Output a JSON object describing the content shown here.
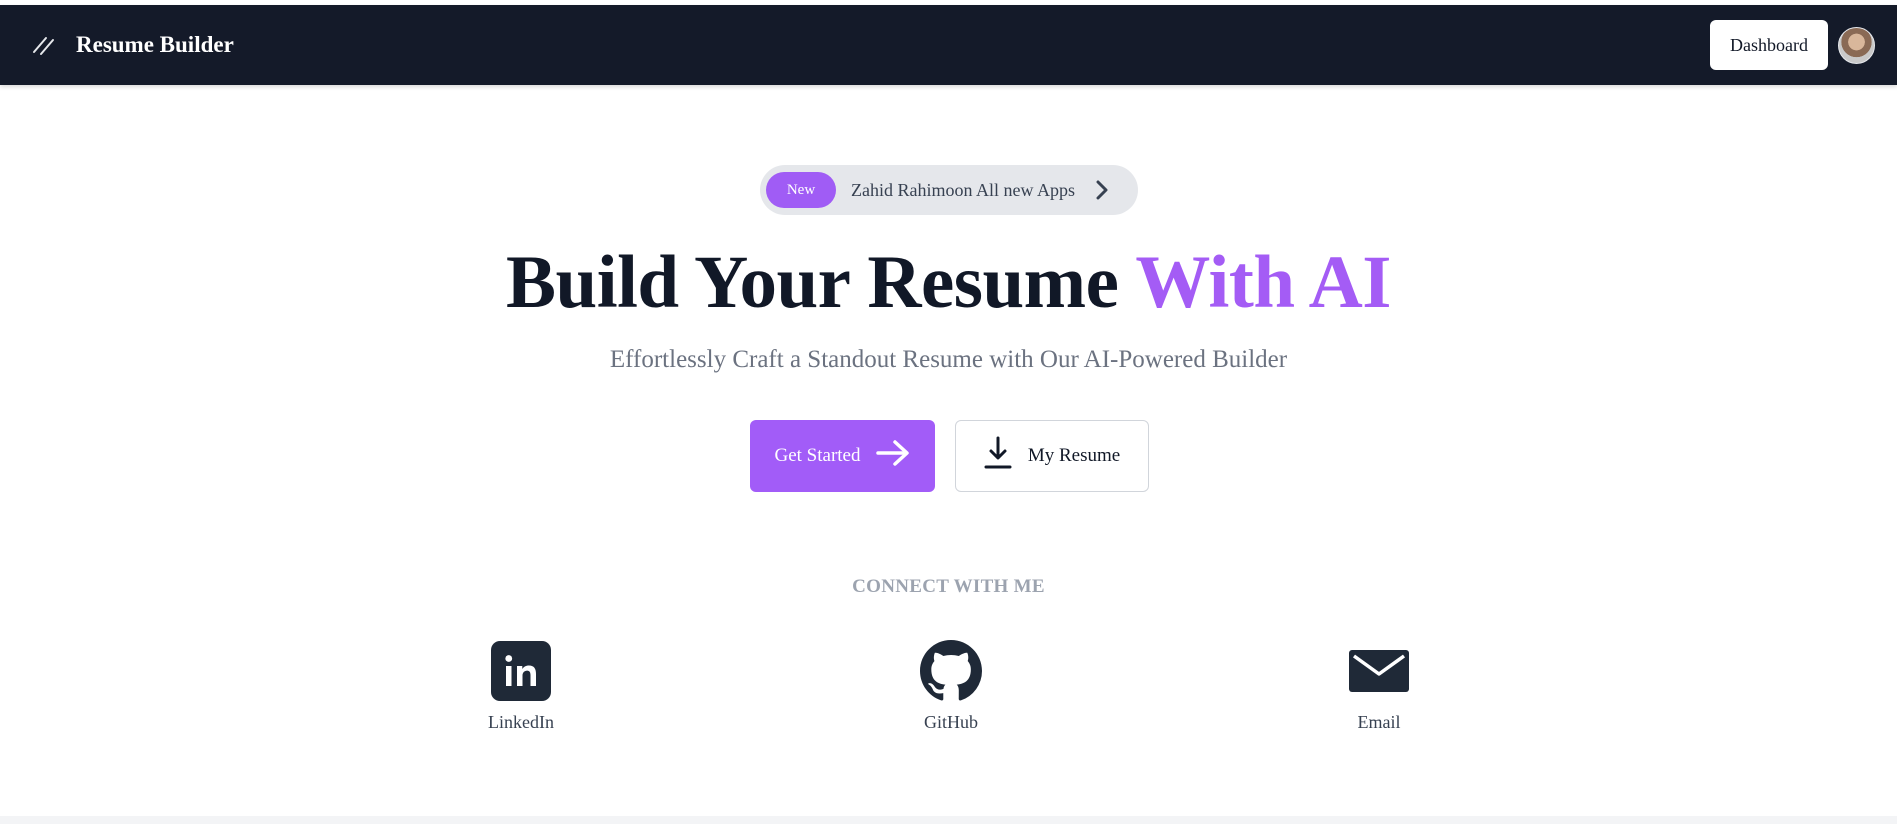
{
  "header": {
    "logo_icon": "slash-logo-icon",
    "title": "Resume Builder",
    "dashboard_label": "Dashboard",
    "avatar_icon": "user-avatar"
  },
  "badge": {
    "new_label": "New",
    "text": "Zahid Rahimoon All new Apps",
    "chevron_icon": "chevron-right-icon"
  },
  "hero": {
    "headline_main": "Build Your Resume",
    "headline_accent": "With AI",
    "subheadline": "Effortlessly Craft a Standout Resume with Our AI-Powered Builder"
  },
  "actions": {
    "get_started_label": "Get Started",
    "get_started_icon": "arrow-right-icon",
    "my_resume_label": "My Resume",
    "my_resume_icon": "download-icon"
  },
  "connect": {
    "title": "CONNECT WITH ME",
    "items": [
      {
        "label": "LinkedIn",
        "icon": "linkedin-icon"
      },
      {
        "label": "GitHub",
        "icon": "github-icon"
      },
      {
        "label": "Email",
        "icon": "email-icon"
      }
    ]
  },
  "colors": {
    "nav_bg": "#141a29",
    "accent": "#a45cf5",
    "text_dark": "#111827",
    "text_muted": "#6b7280"
  }
}
